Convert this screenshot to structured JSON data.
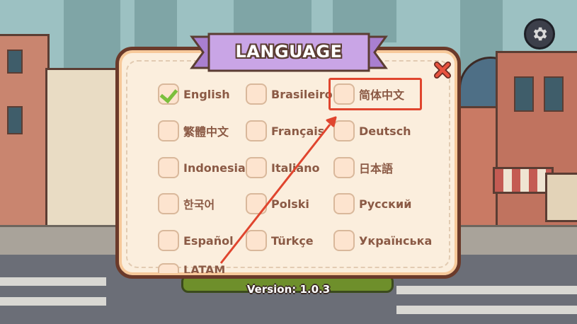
{
  "dialog": {
    "title": "LANGUAGE"
  },
  "languages": [
    {
      "label": "English",
      "checked": true
    },
    {
      "label": "Brasileiro",
      "checked": false
    },
    {
      "label": "简体中文",
      "checked": false
    },
    {
      "label": "繁體中文",
      "checked": false
    },
    {
      "label": "Français",
      "checked": false
    },
    {
      "label": "Deutsch",
      "checked": false
    },
    {
      "label": "Indonesia",
      "checked": false
    },
    {
      "label": "Italiano",
      "checked": false
    },
    {
      "label": "日本語",
      "checked": false
    },
    {
      "label": "한국어",
      "checked": false
    },
    {
      "label": "Polski",
      "checked": false
    },
    {
      "label": "Русский",
      "checked": false
    },
    {
      "label": "Español",
      "checked": false
    },
    {
      "label": "Türkçe",
      "checked": false
    },
    {
      "label": "Українська",
      "checked": false
    },
    {
      "label": "LATAM",
      "checked": false
    }
  ],
  "footer": {
    "version": "Version: 1.0.3"
  },
  "icons": {
    "settings": "gear-icon",
    "close": "close-icon",
    "check": "checkmark-icon"
  },
  "colors": {
    "dialog_bg": "#fbeedd",
    "dialog_border": "#6b3a2a",
    "ribbon": "#c9a5e6",
    "label_text": "#8b5a45",
    "highlight": "#e0452e",
    "check": "#7bbf3c"
  }
}
